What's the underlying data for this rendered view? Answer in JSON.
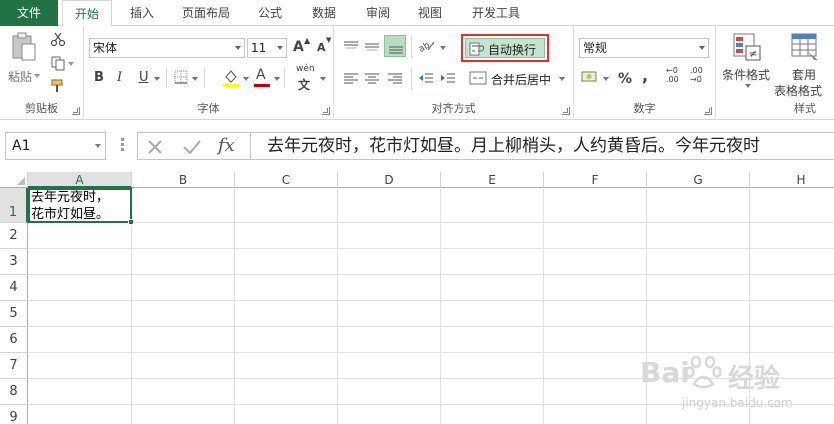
{
  "tabs": [
    {
      "label": "文件"
    },
    {
      "label": "开始"
    },
    {
      "label": "插入"
    },
    {
      "label": "页面布局"
    },
    {
      "label": "公式"
    },
    {
      "label": "数据"
    },
    {
      "label": "审阅"
    },
    {
      "label": "视图"
    },
    {
      "label": "开发工具"
    }
  ],
  "ribbon": {
    "clipboard": {
      "paste_label": "粘贴",
      "group_label": "剪贴板"
    },
    "font": {
      "font_name": "宋体",
      "font_size": "11",
      "bold": "B",
      "italic": "I",
      "underline": "U",
      "grow": "A",
      "shrink": "A",
      "font_color_letter": "A",
      "phonetic": "wén",
      "group_label": "字体"
    },
    "alignment": {
      "wrap_text_label": "自动换行",
      "merge_center_label": "合并后居中",
      "group_label": "对齐方式"
    },
    "number": {
      "format": "常规",
      "percent": "%",
      "comma": ",",
      "inc_decimal": "←0 .00",
      "dec_decimal": ".00 →0",
      "group_label": "数字"
    },
    "styles": {
      "conditional_label": "条件格式",
      "table_format_label_1": "套用",
      "table_format_label_2": "表格格式",
      "group_label": "样式"
    },
    "accent_color": "#217346",
    "highlight_box_color": "#e03030"
  },
  "formula_bar": {
    "name_box": "A1",
    "fx": "fx",
    "content": "去年元夜时，花市灯如昼。月上柳梢头，人约黄昏后。今年元夜时"
  },
  "sheet": {
    "columns": [
      "A",
      "B",
      "C",
      "D",
      "E",
      "F",
      "G",
      "H"
    ],
    "rows": [
      "1",
      "2",
      "3",
      "4",
      "5",
      "6",
      "7",
      "8",
      "9"
    ],
    "a1_line1": "去年元夜时，",
    "a1_line2": "花市灯如昼。"
  },
  "watermark": {
    "brand": "Bai",
    "brand2": "经验",
    "url": "jingyan.baidu.com"
  }
}
